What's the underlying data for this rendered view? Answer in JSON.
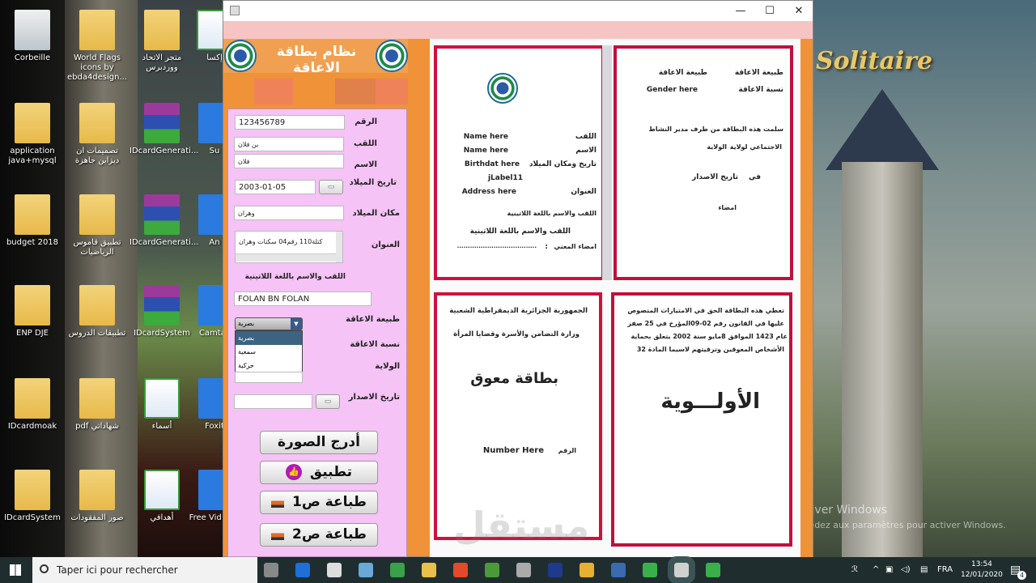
{
  "desktop": {
    "icons": [
      {
        "label": "Corbeille",
        "type": "bin"
      },
      {
        "label": "World Flags icons by ebda4design...",
        "type": "folder"
      },
      {
        "label": "متجر الاتحاد ووردبرس",
        "type": "folder"
      },
      {
        "label": "إكسا",
        "type": "xls"
      },
      {
        "label": "application java+mysql",
        "type": "folder"
      },
      {
        "label": "تصميمات ان ديزاين جاهزة",
        "type": "folder"
      },
      {
        "label": "IDcardGenerati...",
        "type": "rar"
      },
      {
        "label": "Su",
        "type": "app"
      },
      {
        "label": "budget 2018",
        "type": "folder"
      },
      {
        "label": "تطبيق قاموس الرياضيات",
        "type": "folder"
      },
      {
        "label": "IDcardGenerati...",
        "type": "rar"
      },
      {
        "label": "An",
        "type": "app"
      },
      {
        "label": "ENP DJE",
        "type": "folder"
      },
      {
        "label": "تطبيقات الدروس",
        "type": "folder"
      },
      {
        "label": "IDcardSystem",
        "type": "rar"
      },
      {
        "label": "Camtas",
        "type": "app"
      },
      {
        "label": "IDcardmoak",
        "type": "folder"
      },
      {
        "label": "pdf شهاداتي",
        "type": "folder"
      },
      {
        "label": "أسماء",
        "type": "xls"
      },
      {
        "label": "Foxit",
        "type": "app"
      },
      {
        "label": "IDcardSystem",
        "type": "folder"
      },
      {
        "label": "صور المفقودات",
        "type": "folder"
      },
      {
        "label": "أهدافي",
        "type": "xls"
      },
      {
        "label": "Free Vid Con",
        "type": "app"
      }
    ],
    "wallpaper_text": "Solitaire",
    "activate_title": "Activer Windows",
    "activate_sub": "Accédez aux paramètres pour activer Windows.",
    "watermark": "مستقل"
  },
  "window": {
    "controls": {
      "minimize": "—",
      "maximize": "☐",
      "close": "✕"
    },
    "header_title": "نظام بطاقة الاعاقة",
    "form": {
      "number_label": "الرقم",
      "number_value": "123456789",
      "surname_label": "اللقب",
      "surname_value": "بن فلان",
      "name_label": "الاسم",
      "name_value": "فلان",
      "birthdate_label": "تاريخ الميلاد",
      "birthdate_value": "2003-01-05",
      "birthplace_label": "مكان الميلاد",
      "birthplace_value": "وهران",
      "address_label": "العنوان",
      "address_value": "كتلة110  رقم04 سكنات وهران",
      "latin_label": "اللقب والاسم باللغة اللاتينية",
      "latin_value": "FOLAN BN FOLAN",
      "disability_type_label": "طبيعة الاعاقة",
      "disability_type_value": "بصرية",
      "disability_options": [
        "بصرية",
        "سمعية",
        "حركية"
      ],
      "disability_rate_label": "نسبة الاعاقة",
      "wilaya_label": "الولاية",
      "issue_date_label": "تاريخ الاصدار",
      "issue_date_value": ""
    },
    "buttons": {
      "insert_photo": "أدرج الصورة",
      "apply": "تطبيق",
      "print1": "طباعة ص1",
      "print2": "طباعة ص2"
    },
    "card_front": {
      "surname_label": "اللقب",
      "surname_value": "Name here",
      "name_label": "الاسم",
      "name_value": "Name here",
      "birth_label": "تاريخ ومكان الميلاد",
      "birth_value": "Birthdat here",
      "extra_label": "jLabel11",
      "address_label": "العنوان",
      "address_value": "Address here",
      "latin_label": "اللقب والاسم باللغة اللاتينية",
      "latin_value": "اللقب والاسم باللغة اللاتينية",
      "signature_label": "امضاء المعني",
      "signature_colon": ":",
      "signature_line": "....................................."
    },
    "card_back": {
      "type_label": "طبيعة الاعاقة",
      "type_value": "طبيعة الاعاقة",
      "rate_label": "نسبة الاعاقة",
      "rate_value": "Gender here",
      "issued_line1": "سلمت هذه البطاقة من طرف مدير النشاط",
      "issued_line2": "الاجتماعي لولاية",
      "wilaya_value": "الولاية",
      "on_label": "في",
      "issue_date_value": "تاريخ الاصدار",
      "signature": "امضاء"
    },
    "card_cover": {
      "republic": "الجمهورية الجزائرية الديمقراطية الشعبية",
      "ministry": "وزارة التضامن والأسرة وقضايا المرأة",
      "title": "بطاقة معوق",
      "number_label": "الرقم",
      "number_value": "Number Here"
    },
    "card_priority": {
      "text_lines": [
        "تعطي هذه البطاقة الحق  في الامتيازات المنصوص",
        "عليها في القانون رقم 02-09المؤرخ في   25  صفر",
        "عام  1423 الموافق 8مايو سنة  2002  يتعلق بحماية",
        "الأشخاص المعوقين وترقيتهم لاسيما المادة 32"
      ],
      "title": "الأولـــوية"
    }
  },
  "taskbar": {
    "search_placeholder": "Taper ici pour rechercher",
    "language": "FRA",
    "time": "13:54",
    "date": "12/01/2020",
    "notification_count": "4"
  }
}
